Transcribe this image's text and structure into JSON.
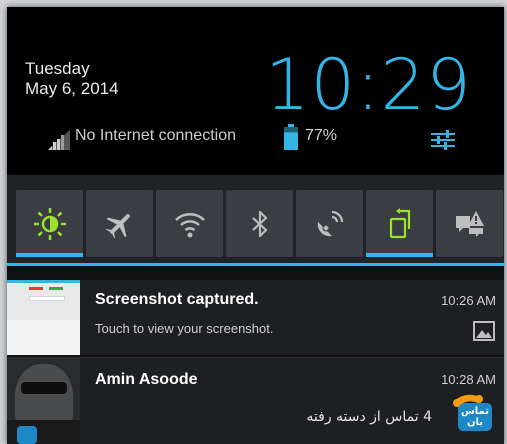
{
  "header": {
    "day": "Tuesday",
    "date": "May 6, 2014",
    "time": "10:29",
    "network_status": "No Internet connection",
    "battery_percent": "77%",
    "battery_level": 0.77
  },
  "quick_settings": {
    "accent_color": "#33b5e5",
    "tiles": [
      {
        "icon": "brightness-icon",
        "active": true
      },
      {
        "icon": "airplane-icon",
        "active": false
      },
      {
        "icon": "wifi-icon",
        "active": false
      },
      {
        "icon": "bluetooth-icon",
        "active": false
      },
      {
        "icon": "gps-icon",
        "active": false
      },
      {
        "icon": "auto-rotate-icon",
        "active": true
      },
      {
        "icon": "notification-settings-icon",
        "active": false
      }
    ]
  },
  "notifications": [
    {
      "title": "Screenshot captured.",
      "text": "Touch to view your screenshot.",
      "time": "10:26 AM",
      "icon": "image-icon"
    },
    {
      "title": "Amin Asoode",
      "text": "4 تماس از دسته رفته",
      "time": "10:28 AM",
      "app_icon_label": "تماس بان",
      "icon": "phone-app-icon"
    }
  ]
}
